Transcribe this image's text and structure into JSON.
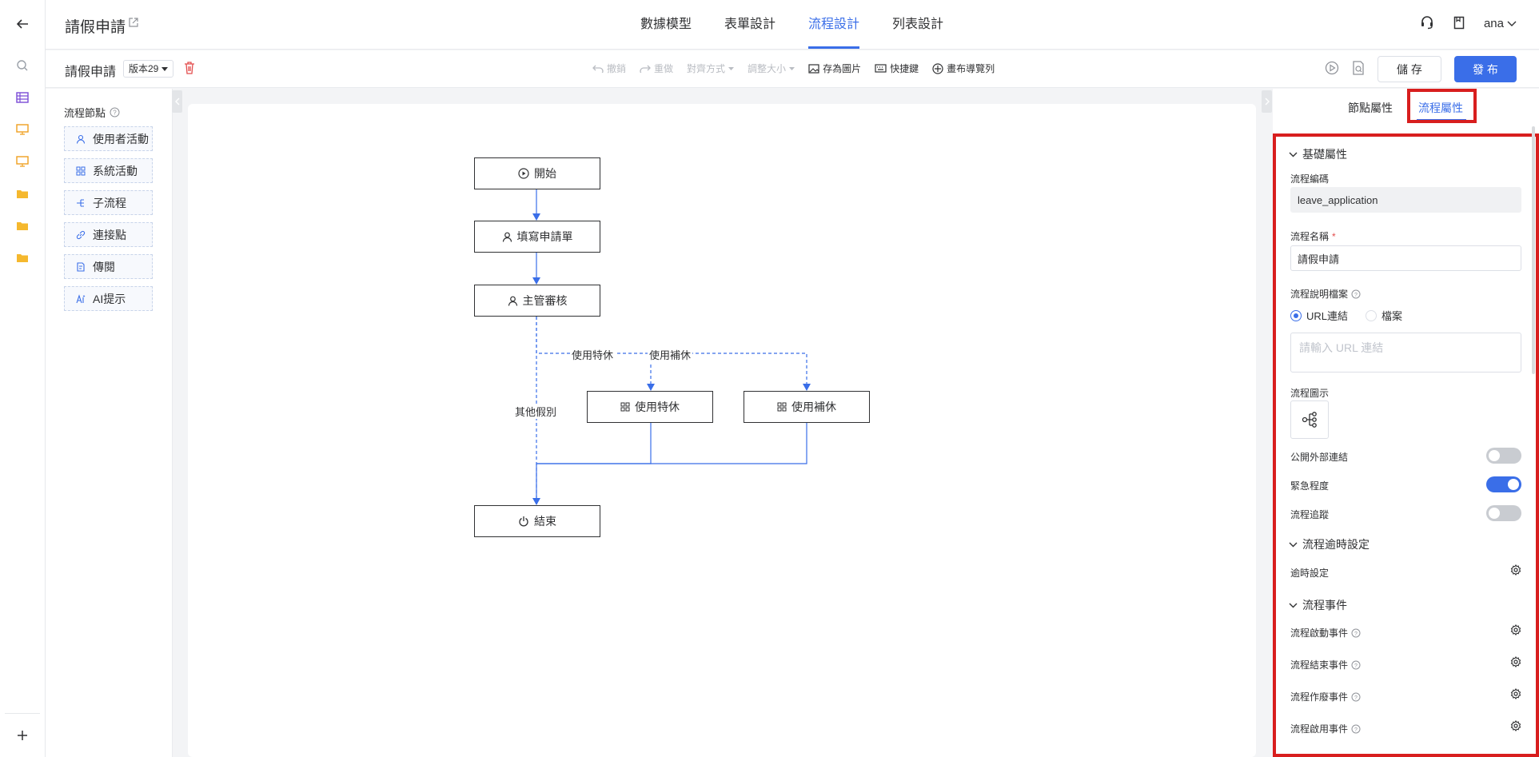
{
  "header": {
    "title": "請假申請",
    "tabs": [
      {
        "label": "數據模型"
      },
      {
        "label": "表單設計"
      },
      {
        "label": "流程設計"
      },
      {
        "label": "列表設計"
      }
    ],
    "user": "ana"
  },
  "toolbar": {
    "title": "請假申請",
    "version": "版本29",
    "undo": "撤銷",
    "redo": "重做",
    "align": "對齊方式",
    "resize": "調整大小",
    "save_image": "存為圖片",
    "shortcuts": "快捷鍵",
    "canvas_nav": "畫布導覽列",
    "save": "儲 存",
    "publish": "發 布"
  },
  "palette": {
    "title": "流程節點",
    "items": [
      {
        "label": "使用者活動",
        "icon": "user-icon"
      },
      {
        "label": "系統活動",
        "icon": "grid-icon"
      },
      {
        "label": "子流程",
        "icon": "subprocess-icon"
      },
      {
        "label": "連接點",
        "icon": "link-icon"
      },
      {
        "label": "傳閱",
        "icon": "circulate-icon"
      },
      {
        "label": "AI提示",
        "icon": "ai-icon"
      }
    ]
  },
  "flow": {
    "nodes": {
      "start": "開始",
      "fill": "填寫申請單",
      "review": "主管審核",
      "special": "使用特休",
      "comp": "使用補休",
      "end": "結束"
    },
    "edges": {
      "special": "使用特休",
      "comp": "使用補休",
      "other": "其他假別"
    }
  },
  "panel": {
    "tabs": {
      "node": "節點屬性",
      "flow": "流程屬性"
    },
    "basic_section": "基礎屬性",
    "code_label": "流程編碼",
    "code_value": "leave_application",
    "name_label": "流程名稱",
    "name_value": "請假申請",
    "doc_label": "流程說明檔案",
    "radio_url": "URL連結",
    "radio_file": "檔案",
    "url_placeholder": "請輸入 URL 連結",
    "icon_label": "流程圖示",
    "public_link": "公開外部連結",
    "urgency": "緊急程度",
    "trace": "流程追蹤",
    "timeout_section": "流程逾時設定",
    "timeout_label": "逾時設定",
    "events_section": "流程事件",
    "events": [
      {
        "label": "流程啟動事件"
      },
      {
        "label": "流程結束事件"
      },
      {
        "label": "流程作廢事件"
      },
      {
        "label": "流程啟用事件"
      }
    ],
    "switches": {
      "public_link": false,
      "urgency": true,
      "trace": false
    }
  },
  "colors": {
    "accent": "#3a6ee8",
    "highlight": "#d81e1e"
  }
}
